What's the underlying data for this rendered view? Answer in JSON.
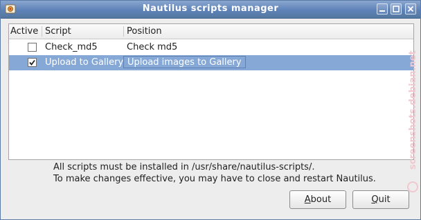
{
  "window": {
    "title": "Nautilus scripts manager",
    "app_icon": "nautilus-app-icon",
    "controls": [
      "minimize-icon",
      "maximize-icon",
      "close-icon"
    ]
  },
  "table": {
    "columns": [
      "Active",
      "Script",
      "Position"
    ],
    "rows": [
      {
        "active": false,
        "script": "Check_md5",
        "position": "Check md5",
        "selected": false
      },
      {
        "active": true,
        "script": "Upload to Gallery",
        "position": "Upload images to Gallery",
        "selected": true
      }
    ]
  },
  "info": {
    "line1": "All scripts must be installed in /usr/share/nautilus-scripts/.",
    "line2": "To make changes effective, you may have to close and restart Nautilus."
  },
  "buttons": {
    "about": {
      "mnemonic": "A",
      "rest": "bout"
    },
    "quit": {
      "mnemonic": "Q",
      "rest": "uit"
    }
  },
  "watermark": "screenshots.debian.net",
  "colors": {
    "titlebar": "#5e82b8",
    "selection": "#86a8d6",
    "window_bg": "#ededed"
  }
}
